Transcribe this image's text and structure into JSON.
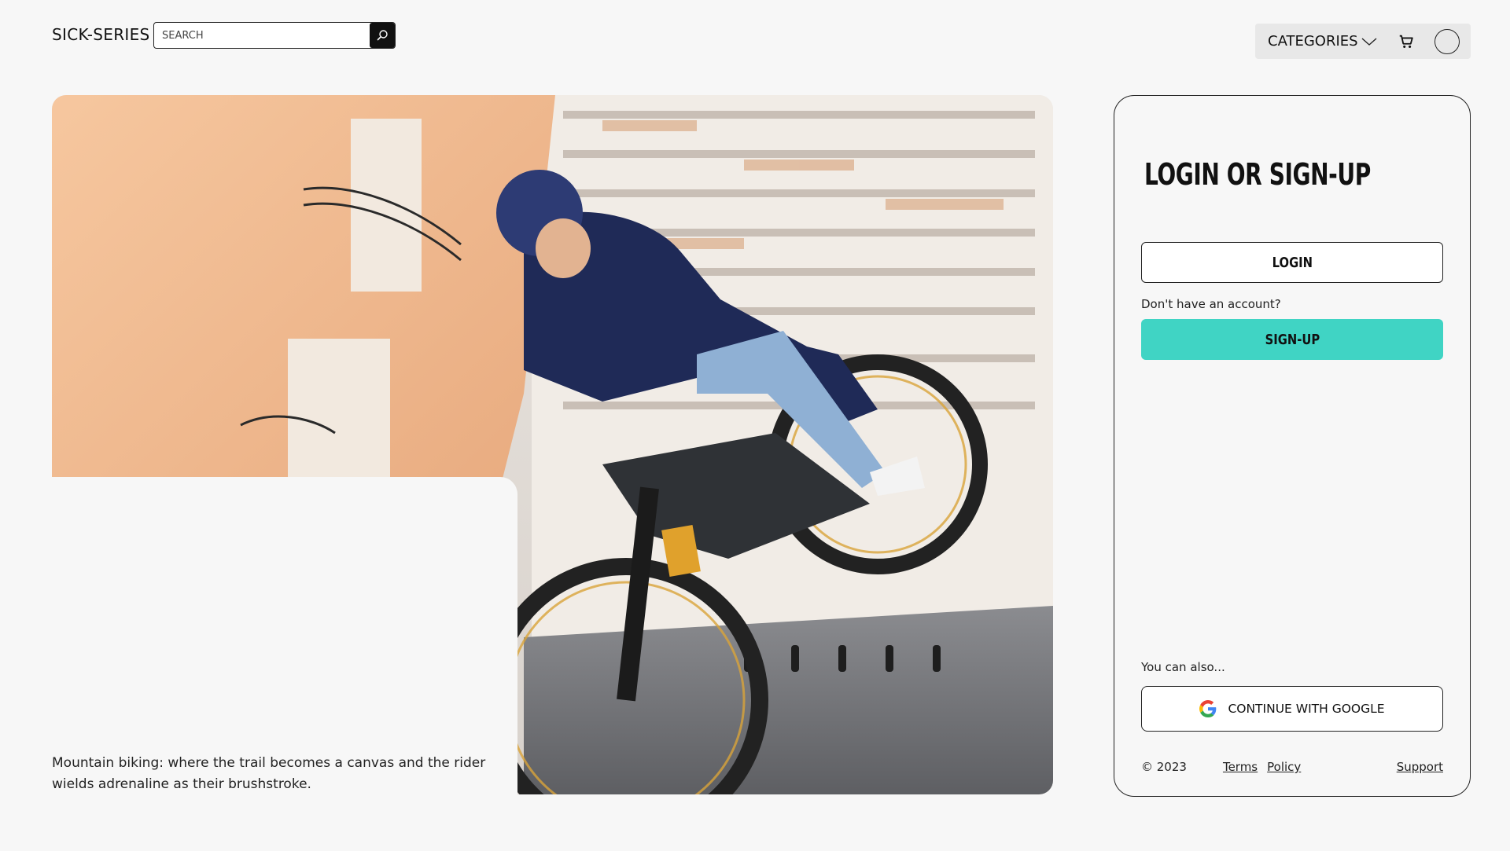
{
  "header": {
    "logo": "SICK-SERIES",
    "search_placeholder": "SEARCH",
    "categories_label": "CATEGORIES"
  },
  "hero": {
    "caption": "Mountain biking: where the trail becomes a canvas and the rider wields adrenaline as their brushstroke."
  },
  "auth": {
    "title": "LOGIN OR SIGN-UP",
    "login_label": "LOGIN",
    "no_account_text": "Don't have an account?",
    "signup_label": "SIGN-UP",
    "also_text": "You can also...",
    "google_label": "CONTINUE WITH GOOGLE"
  },
  "footer": {
    "copyright": "© 2023",
    "terms": "Terms",
    "policy": "Policy",
    "support": "Support"
  },
  "colors": {
    "accent": "#40d4c4",
    "background": "#f7f7f7"
  }
}
